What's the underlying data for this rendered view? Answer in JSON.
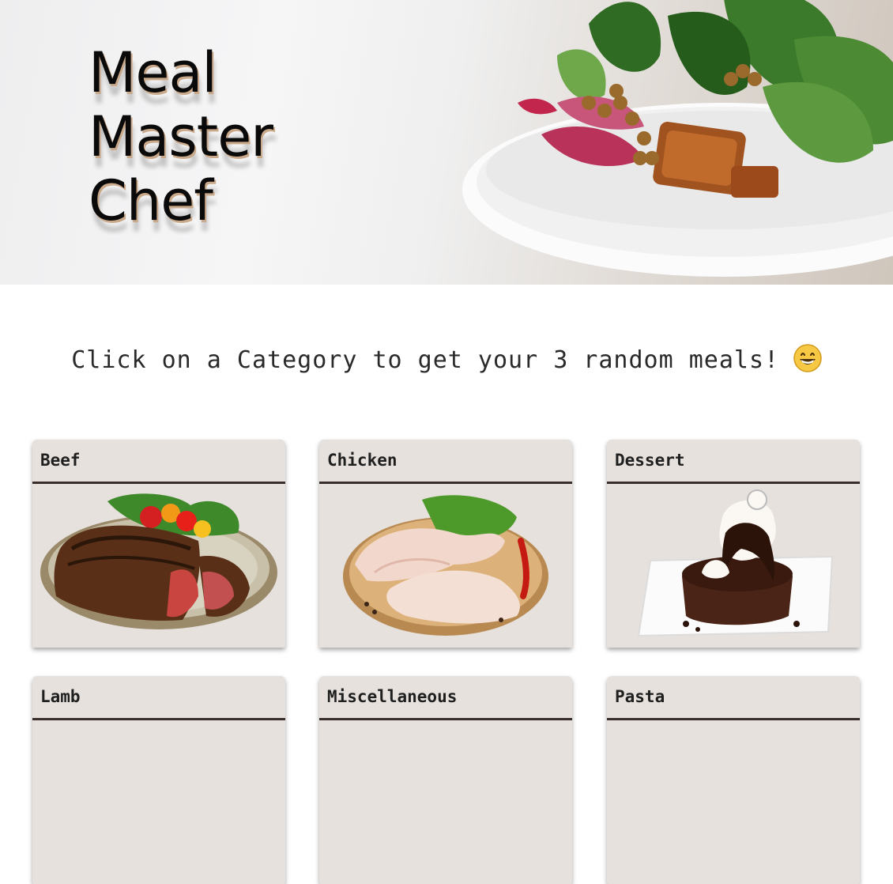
{
  "hero": {
    "title_lines": [
      "Meal",
      "Master",
      "Chef"
    ],
    "image": "salad-bowl-photo"
  },
  "tagline": {
    "text": "Click on a Category to get your 3 random meals!",
    "emoji": "grinning-face-icon"
  },
  "categories": [
    {
      "label": "Beef",
      "image": "steak-plate-photo"
    },
    {
      "label": "Chicken",
      "image": "raw-chicken-board-photo"
    },
    {
      "label": "Dessert",
      "image": "chocolate-cake-photo"
    },
    {
      "label": "Lamb",
      "image": ""
    },
    {
      "label": "Miscellaneous",
      "image": ""
    },
    {
      "label": "Pasta",
      "image": ""
    }
  ],
  "colors": {
    "card_bg": "#e6e1dd",
    "card_divider": "#3a2e2a",
    "text": "#1f1f1f"
  }
}
